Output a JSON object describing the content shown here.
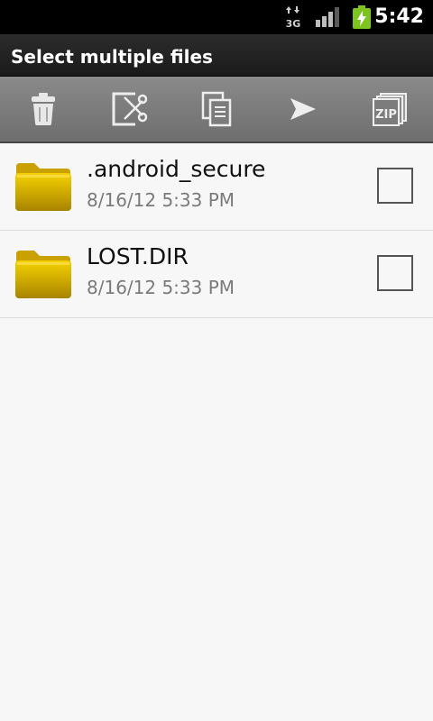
{
  "status_bar": {
    "network_label": "3G",
    "time": "5:42"
  },
  "header": {
    "title": "Select multiple files"
  },
  "toolbar": {
    "actions": [
      {
        "icon": "trash-icon"
      },
      {
        "icon": "cut-icon"
      },
      {
        "icon": "copy-icon"
      },
      {
        "icon": "send-icon"
      },
      {
        "icon": "zip-icon",
        "label": "ZIP"
      }
    ]
  },
  "files": [
    {
      "name": ".android_secure",
      "date": "8/16/12 5:33 PM",
      "checked": false
    },
    {
      "name": "LOST.DIR",
      "date": "8/16/12 5:33 PM",
      "checked": false
    }
  ],
  "colors": {
    "folder": "#e2b800",
    "toolbar": "#7c7c7c",
    "battery": "#7ec41f"
  }
}
